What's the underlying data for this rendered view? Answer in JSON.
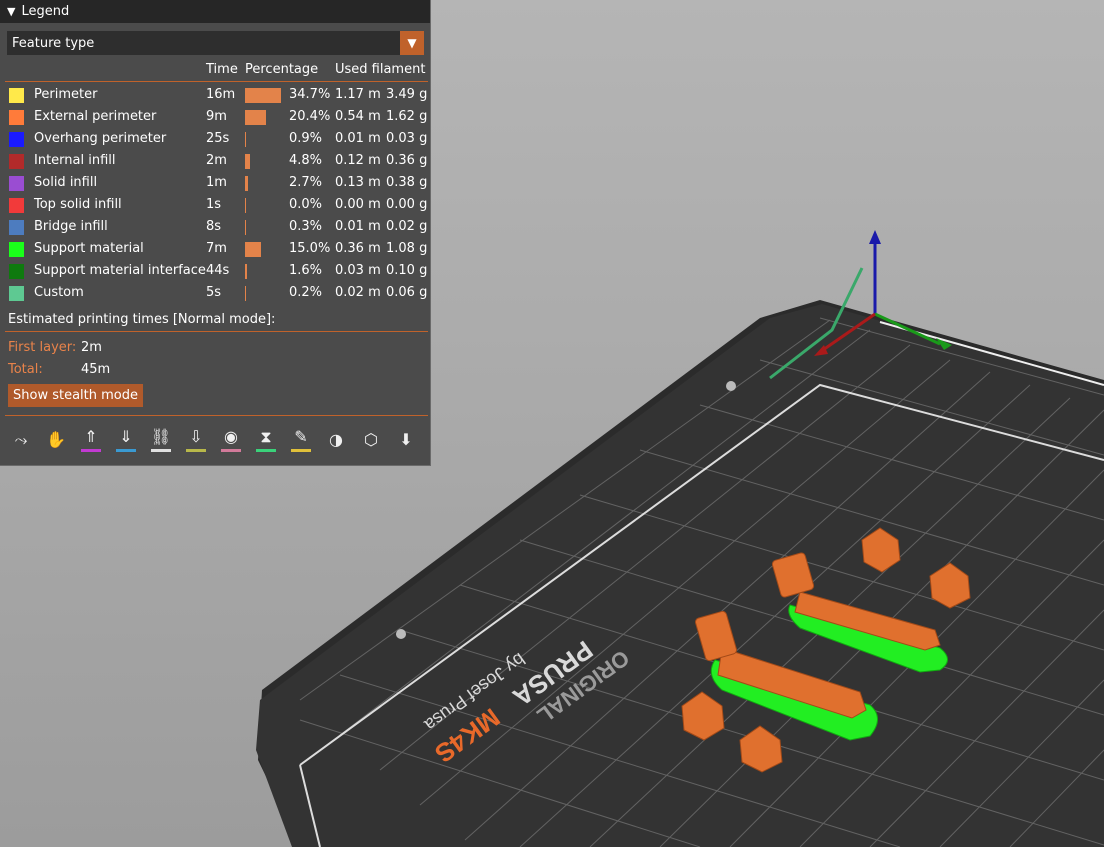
{
  "legend": {
    "title": "Legend",
    "view_type": "Feature type",
    "headers": {
      "time": "Time",
      "percentage": "Percentage",
      "used_filament": "Used filament"
    },
    "rows": [
      {
        "name": "Perimeter",
        "color": "#ffe94a",
        "time": "16m",
        "pct_value": 34.7,
        "pct": "34.7%",
        "length": "1.17 m",
        "weight": "3.49 g"
      },
      {
        "name": "External perimeter",
        "color": "#ff7b3a",
        "time": "9m",
        "pct_value": 20.4,
        "pct": "20.4%",
        "length": "0.54 m",
        "weight": "1.62 g"
      },
      {
        "name": "Overhang perimeter",
        "color": "#1a1aff",
        "time": "25s",
        "pct_value": 0.9,
        "pct": "0.9%",
        "length": "0.01 m",
        "weight": "0.03 g"
      },
      {
        "name": "Internal infill",
        "color": "#b22a2a",
        "time": "2m",
        "pct_value": 4.8,
        "pct": "4.8%",
        "length": "0.12 m",
        "weight": "0.36 g"
      },
      {
        "name": "Solid infill",
        "color": "#9a4dd2",
        "time": "1m",
        "pct_value": 2.7,
        "pct": "2.7%",
        "length": "0.13 m",
        "weight": "0.38 g"
      },
      {
        "name": "Top solid infill",
        "color": "#f23a3a",
        "time": "1s",
        "pct_value": 0.0,
        "pct": "0.0%",
        "length": "0.00 m",
        "weight": "0.00 g"
      },
      {
        "name": "Bridge infill",
        "color": "#4d7cbf",
        "time": "8s",
        "pct_value": 0.3,
        "pct": "0.3%",
        "length": "0.01 m",
        "weight": "0.02 g"
      },
      {
        "name": "Support material",
        "color": "#1aff1a",
        "time": "7m",
        "pct_value": 15.0,
        "pct": "15.0%",
        "length": "0.36 m",
        "weight": "1.08 g"
      },
      {
        "name": "Support material interface",
        "color": "#0e7a0e",
        "time": "44s",
        "pct_value": 1.6,
        "pct": "1.6%",
        "length": "0.03 m",
        "weight": "0.10 g"
      },
      {
        "name": "Custom",
        "color": "#5ec992",
        "time": "5s",
        "pct_value": 0.2,
        "pct": "0.2%",
        "length": "0.02 m",
        "weight": "0.06 g"
      }
    ],
    "estimated_label": "Estimated printing times [Normal mode]:",
    "first_layer_label": "First layer:",
    "first_layer_value": "2m",
    "total_label": "Total:",
    "total_value": "45m",
    "stealth_button": "Show stealth mode",
    "toolbar": [
      {
        "icon": "travel-icon",
        "underline": ""
      },
      {
        "icon": "wipe-icon",
        "underline": ""
      },
      {
        "icon": "retractions-icon",
        "underline": "#c23ad2"
      },
      {
        "icon": "deretractions-icon",
        "underline": "#3a9ad2"
      },
      {
        "icon": "seams-icon",
        "underline": "#e0e0e0"
      },
      {
        "icon": "tool-changes-icon",
        "underline": "#b8b84a"
      },
      {
        "icon": "color-changes-icon",
        "underline": "#d27a9a"
      },
      {
        "icon": "pause-prints-icon",
        "underline": "#3ad27a"
      },
      {
        "icon": "custom-gcodes-icon",
        "underline": "#e0c03a"
      },
      {
        "icon": "center-of-gravity-icon",
        "underline": ""
      },
      {
        "icon": "shells-icon",
        "underline": ""
      },
      {
        "icon": "tool-marker-icon",
        "underline": ""
      }
    ]
  },
  "bed": {
    "brand_line1": "ORIGINAL",
    "brand_line2": "PRUSA",
    "model": "MK4S",
    "byline": "by Josef Prusa",
    "accent": "#e8692a"
  }
}
